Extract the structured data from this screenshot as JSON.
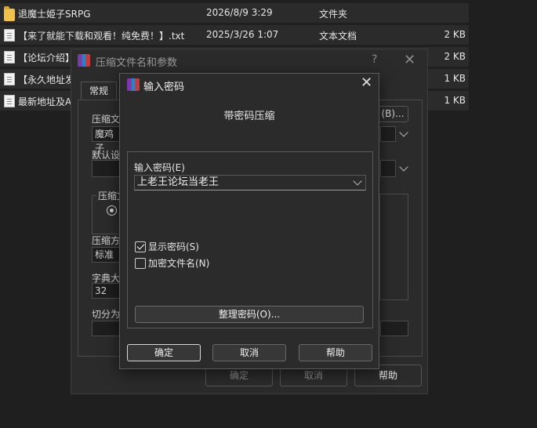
{
  "files": [
    {
      "name": "退魔士姫子SRPG",
      "date": "2026/8/9 3:29",
      "type": "文件夹",
      "size": "",
      "icon": "folder-icon"
    },
    {
      "name": "【来了就能下载和观看！纯免费！】.txt",
      "date": "2025/3/26 1:07",
      "type": "文本文档",
      "size": "2 KB",
      "icon": "text-file-icon"
    },
    {
      "name": "【论坛介绍】",
      "date": "",
      "type": "",
      "size": "2 KB",
      "icon": "text-file-icon"
    },
    {
      "name": "【永久地址发",
      "date": "",
      "type": "",
      "size": "1 KB",
      "icon": "text-file-icon"
    },
    {
      "name": "最新地址及A",
      "date": "",
      "type": "",
      "size": "1 KB",
      "icon": "text-file-icon"
    }
  ],
  "bg_dialog": {
    "title": "压缩文件名和参数",
    "help": "?",
    "close": "✕",
    "tab_general": "常规",
    "archive_name_label": "压缩文",
    "browse_button": "(B)...",
    "archive_name_value": "魔鸡子",
    "default_label": "默认设",
    "format_label": "压缩文",
    "method_label": "压缩方",
    "method_value": "标准",
    "dict_label": "字典大",
    "dict_value": "32",
    "split_label": "切分为",
    "ok": "确定",
    "cancel": "取消",
    "help_button": "帮助"
  },
  "pw_dialog": {
    "title": "输入密码",
    "close": "✕",
    "header": "带密码压缩",
    "password_label": "输入密码(E)",
    "password_value": "上老王论坛当老王",
    "show_password": "显示密码(S)",
    "show_password_checked": true,
    "encrypt_names": "加密文件名(N)",
    "encrypt_names_checked": false,
    "organize_button": "整理密码(O)...",
    "ok": "确定",
    "cancel": "取消",
    "help": "帮助"
  }
}
